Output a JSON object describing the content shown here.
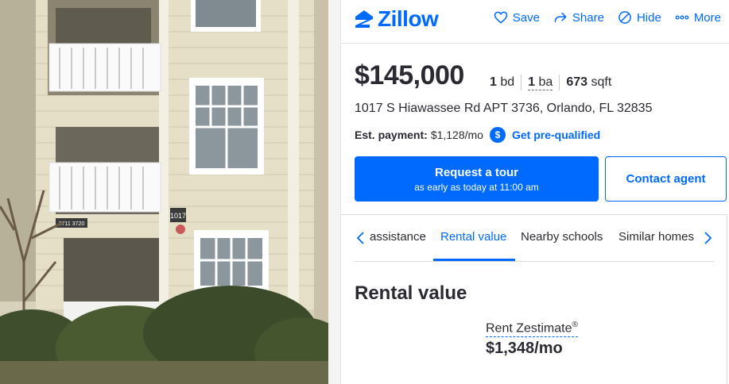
{
  "photo": {
    "building_number": "1017",
    "unit_sign": "3711 3720"
  },
  "brand": {
    "name": "Zillow",
    "color": "#006aff"
  },
  "actions": [
    {
      "label": "Save",
      "icon": "heart-icon"
    },
    {
      "label": "Share",
      "icon": "share-icon"
    },
    {
      "label": "Hide",
      "icon": "hide-icon"
    },
    {
      "label": "More",
      "icon": "more-icon"
    }
  ],
  "listing": {
    "price": "$145,000",
    "beds_value": "1",
    "beds_unit": "bd",
    "baths_value": "1",
    "baths_unit": "ba",
    "sqft_value": "673",
    "sqft_unit": "sqft",
    "address": "1017 S Hiawassee Rd APT 3736, Orlando, FL 32835"
  },
  "payment": {
    "label": "Est. payment:",
    "value": "$1,128/mo",
    "badge": "$",
    "prequal_label": "Get pre-qualified"
  },
  "buttons": {
    "tour_main": "Request a tour",
    "tour_sub": "as early as today at 11:00 am",
    "contact": "Contact agent"
  },
  "tabs": [
    {
      "label": "assistance",
      "active": false
    },
    {
      "label": "Rental value",
      "active": true
    },
    {
      "label": "Nearby schools",
      "active": false
    },
    {
      "label": "Similar homes",
      "active": false
    }
  ],
  "rental": {
    "section_title": "Rental value",
    "zestimate_label": "Rent Zestimate",
    "zestimate_mark": "®",
    "zestimate_value": "$1,348/mo"
  }
}
